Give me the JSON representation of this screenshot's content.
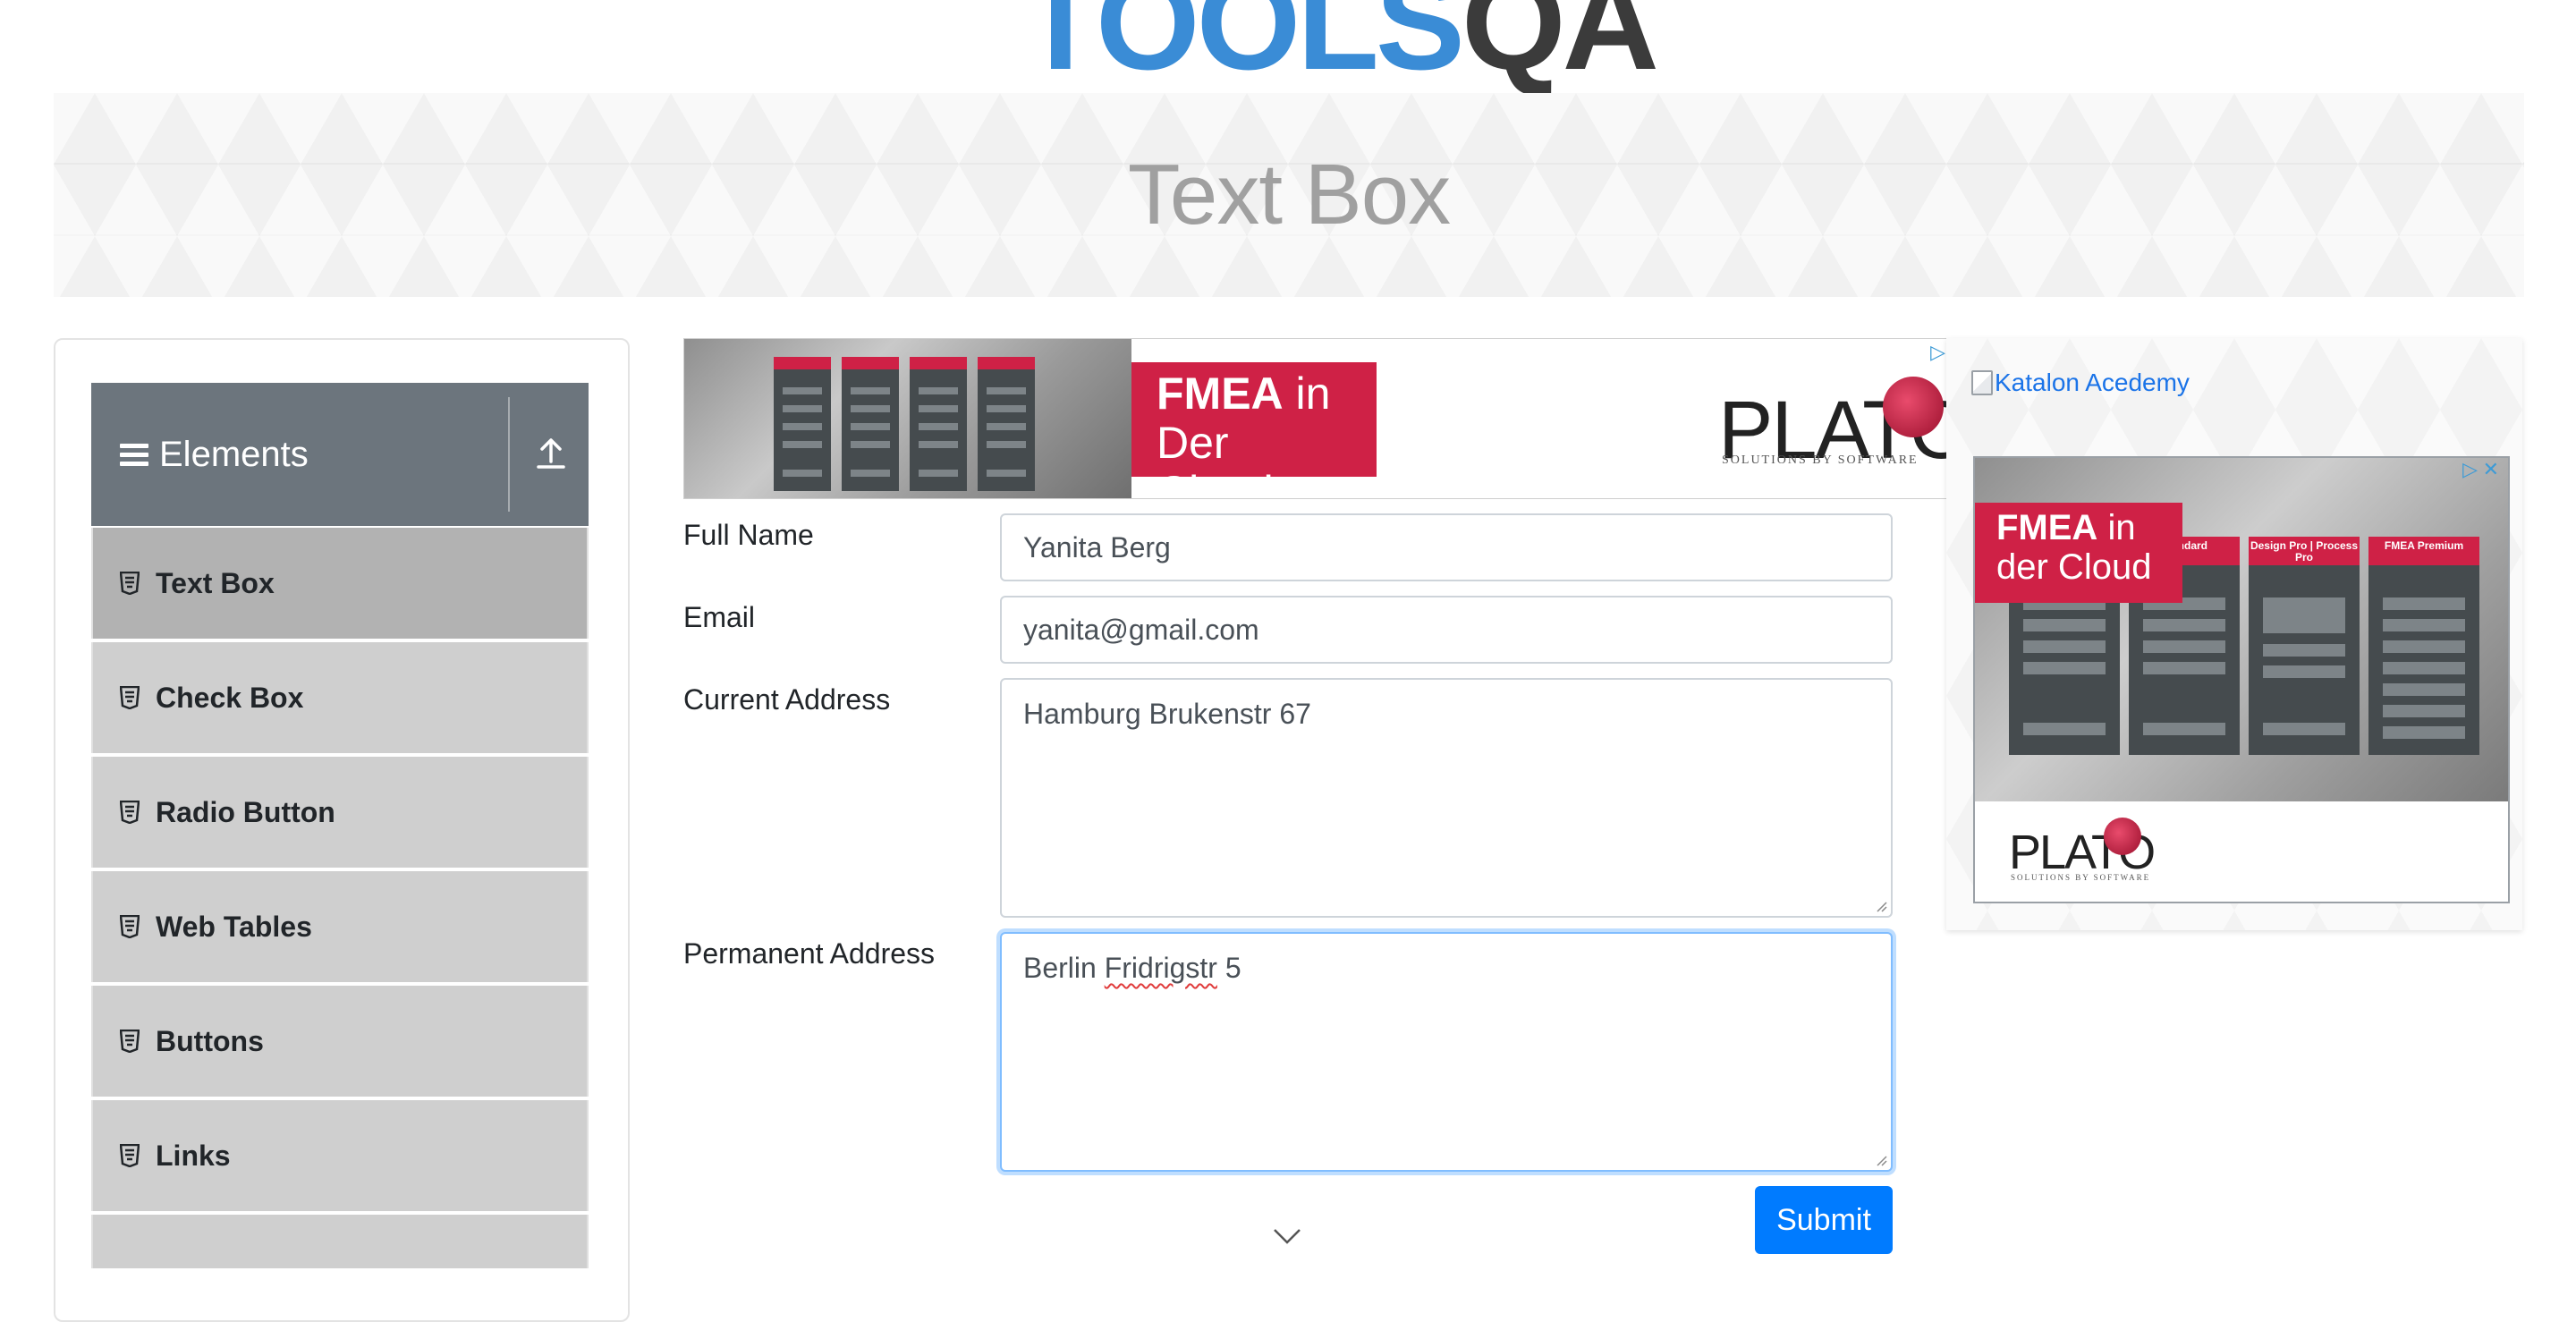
{
  "logo": {
    "part1": "TOOLS",
    "part2": "QA"
  },
  "banner": {
    "title": "Text Box"
  },
  "sidebar": {
    "group_title": "Elements",
    "items": [
      {
        "label": "Text Box"
      },
      {
        "label": "Check Box"
      },
      {
        "label": "Radio Button"
      },
      {
        "label": "Web Tables"
      },
      {
        "label": "Buttons"
      },
      {
        "label": "Links"
      }
    ]
  },
  "ad_top": {
    "headline_bold": "FMEA",
    "headline_rest": " in",
    "headline_line2": "Der Cloud",
    "brand": "PLATO",
    "brand_sub": "SOLUTIONS BY SOFTWARE"
  },
  "form": {
    "full_name": {
      "label": "Full Name",
      "value": "Yanita Berg"
    },
    "email": {
      "label": "Email",
      "value": "yanita@gmail.com"
    },
    "current_address": {
      "label": "Current Address",
      "value": "Hamburg Brukenstr 67"
    },
    "permanent_address": {
      "label": "Permanent Address",
      "value_start": "Berlin ",
      "value_misspelled": "Fridrigstr",
      "value_end": " 5"
    },
    "submit_label": "Submit"
  },
  "ad_side": {
    "link_alt": "Katalon Acedemy",
    "headline_bold": "FMEA",
    "headline_rest": " in",
    "headline_line2": "der Cloud",
    "columns": [
      "Standard",
      "Design Pro | Process Pro",
      "FMEA Premium"
    ],
    "brand": "PLATO",
    "brand_sub": "SOLUTIONS BY SOFTWARE"
  },
  "colors": {
    "primary": "#007bff",
    "sidebar_header": "#6c757d",
    "menu_item": "#cfcfcf",
    "menu_item_active": "#b2b2b2",
    "ad_red": "#cf2146",
    "logo_blue": "#3a8cd6"
  }
}
